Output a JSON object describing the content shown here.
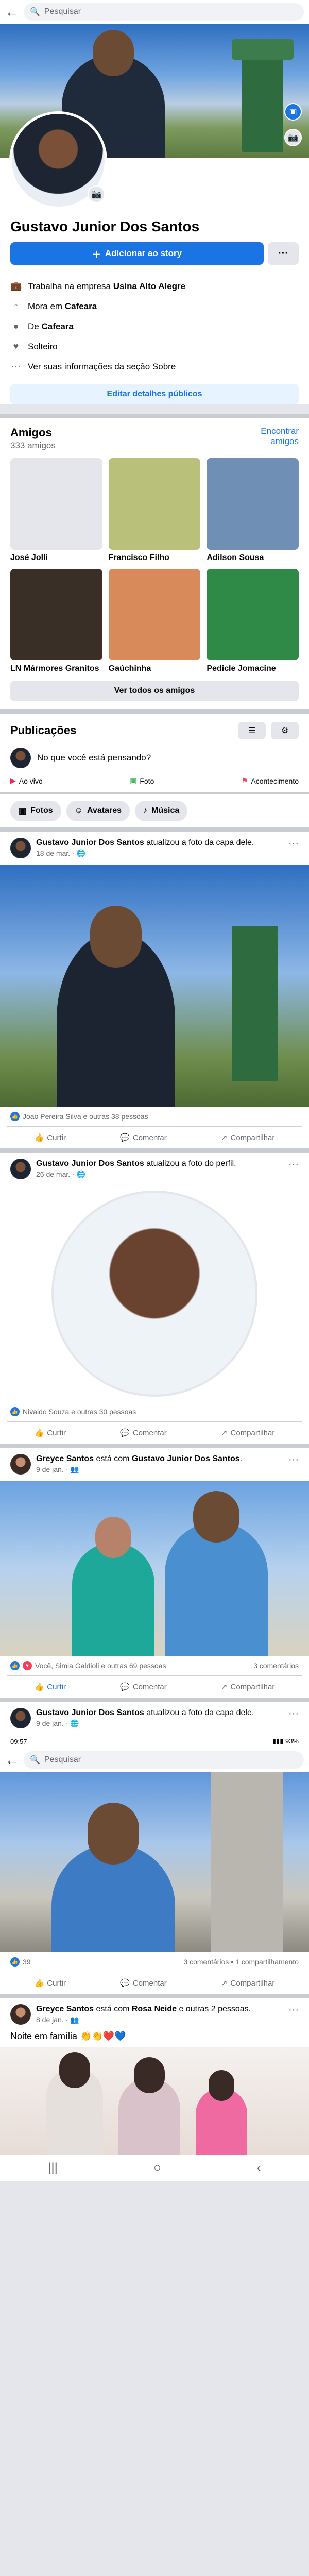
{
  "search": {
    "placeholder": "Pesquisar",
    "back_icon": "back-arrow-icon"
  },
  "profile": {
    "name": "Gustavo Junior Dos Santos",
    "add_story": "Adicionar ao story",
    "more": "···",
    "info": [
      {
        "icon": "briefcase-icon",
        "pre": "Trabalha na empresa ",
        "bold": "Usina Alto Alegre"
      },
      {
        "icon": "home-icon",
        "pre": "Mora em ",
        "bold": "Cafeara"
      },
      {
        "icon": "location-icon",
        "pre": "De ",
        "bold": "Cafeara"
      },
      {
        "icon": "heart-icon",
        "pre": "Solteiro",
        "bold": ""
      },
      {
        "icon": "more-icon",
        "pre": "Ver suas informações da seção Sobre",
        "bold": ""
      }
    ],
    "edit_details": "Editar detalhes públicos"
  },
  "friends": {
    "title": "Amigos",
    "count": "333 amigos",
    "find": "Encontrar amigos",
    "items": [
      {
        "name": "José Jolli",
        "color": "#e4e6eb"
      },
      {
        "name": "Francisco Filho",
        "color": "#b9c07a"
      },
      {
        "name": "Adilson Sousa",
        "color": "#6f8fb5"
      },
      {
        "name": "LN Mármores Granitos",
        "color": "#3a2f27"
      },
      {
        "name": "Gaúchinha",
        "color": "#d98a5a"
      },
      {
        "name": "Pedicle Jomacine",
        "color": "#2f8a47"
      }
    ],
    "all": "Ver todos os amigos"
  },
  "publications": {
    "title": "Publicações",
    "composer": "No que você está pensando?",
    "quick": [
      {
        "icon": "live-icon",
        "label": "Ao vivo",
        "color": "#f02849"
      },
      {
        "icon": "photo-icon",
        "label": "Foto",
        "color": "#45bd62"
      },
      {
        "icon": "event-icon",
        "label": "Acontecimento",
        "color": "#f3425f"
      }
    ],
    "chips": [
      {
        "icon": "photos-icon",
        "label": "Fotos"
      },
      {
        "icon": "avatars-icon",
        "label": "Avatares"
      },
      {
        "icon": "music-icon",
        "label": "Música"
      }
    ]
  },
  "posts": [
    {
      "author": "Gustavo Junior Dos Santos",
      "action": " atualizou a foto da capa dele.",
      "date": "18 de mar.",
      "reactions": "Joao Pereira Silva e outras 38 pessoas",
      "comments": ""
    },
    {
      "author": "Gustavo Junior Dos Santos",
      "action": " atualizou a foto do perfil.",
      "date": "26 de mar.",
      "reactions": "Nivaldo Souza e outras 30 pessoas",
      "comments": ""
    },
    {
      "author": "Greyce Santos",
      "action": " está com ",
      "with": "Gustavo Junior Dos Santos",
      "suffix": ".",
      "date": "9 de jan.",
      "reactions": "Você, Simia Galdioli e outras 69 pessoas",
      "comments": "3 comentários"
    },
    {
      "author": "Gustavo Junior Dos Santos",
      "action": " atualizou a foto da capa dele.",
      "date": "9 de jan.",
      "reactions": "39",
      "comments": "3 comentários • 1 compartilhamento"
    },
    {
      "author": "Greyce Santos",
      "action": " está com ",
      "with": "Rosa Neide",
      "suffix": " e outras 2 pessoas.",
      "date": "8 de jan.",
      "text": "Noite em família 👏👏❤️💙"
    }
  ],
  "actions": {
    "like": "Curtir",
    "comment": "Comentar",
    "share": "Compartilhar"
  },
  "statusbar": {
    "time": "09:57",
    "battery": "93%"
  },
  "colors": {
    "accent": "#1b74e4",
    "page_bg": "#e4e6eb"
  }
}
